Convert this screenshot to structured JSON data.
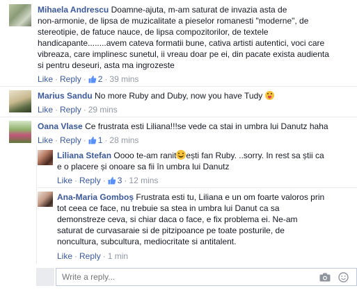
{
  "comments": [
    {
      "author": "Mihaela Andrescu",
      "lines": [
        "Doamne-ajuta, m-am saturat de invazia asta de",
        "non-armonie, de lipsa de muzicalitate a pieselor romanesti \"moderne\", de",
        "stereotipie, de fatuce nauce, de lipsa compozitorilor, de textele",
        "handicapante........avem cateva formatii bune, cativa artisti autentici, voci care",
        "vibreaza, care implinesc sunetul, ii vreau doar pe ei, din pacate exista audienta",
        "si pentru deseuri, asta ma ingrozeste"
      ],
      "like": "Like",
      "reply": "Reply",
      "likes": "2",
      "time": "39 mins"
    },
    {
      "author": "Marius Sandu",
      "text": "No more Ruby and Duby, now you have Tudy",
      "emoji": "tongue-emoji",
      "like": "Like",
      "reply": "Reply",
      "time": "29 mins"
    },
    {
      "author": "Oana Vlase",
      "text": "Ce frustrata esti Liliana!!!se vede ca stai in umbra lui Danutz haha",
      "like": "Like",
      "reply": "Reply",
      "likes": "1",
      "time": "28 mins"
    }
  ],
  "replies": [
    {
      "author": "Liliana Stefan",
      "text_before": "Oooo te-am ranit",
      "text_after": "ești fan Ruby. ..sorry. In rest sa știi ca",
      "line2": "e o placere și onoare sa fii în umbra lui Danutz",
      "emoji": "smile-emoji",
      "like": "Like",
      "reply": "Reply",
      "likes": "3",
      "time": "12 mins"
    },
    {
      "author": "Ana-Maria Gomboș",
      "lines": [
        "Frustrata esti tu, Liliana e un om foarte valoros prin",
        "tot ceea ce face, nu trebuie sa stea in umbra lui Danut ca sa",
        "demonstreze ceva, si chiar daca o face, e fix problema ei. Ne-am",
        "saturat de curvasaraie si de pitzipoance pe toate posturile, de",
        "noncultura, subcultura, mediocritate si antitalent."
      ],
      "like": "Like",
      "reply": "Reply",
      "time": "1 min"
    }
  ],
  "reply_box": {
    "placeholder": "Write a reply..."
  },
  "colors": {
    "author": "#3b5998",
    "meta": "#9197a3",
    "border": "#e9ebee"
  }
}
